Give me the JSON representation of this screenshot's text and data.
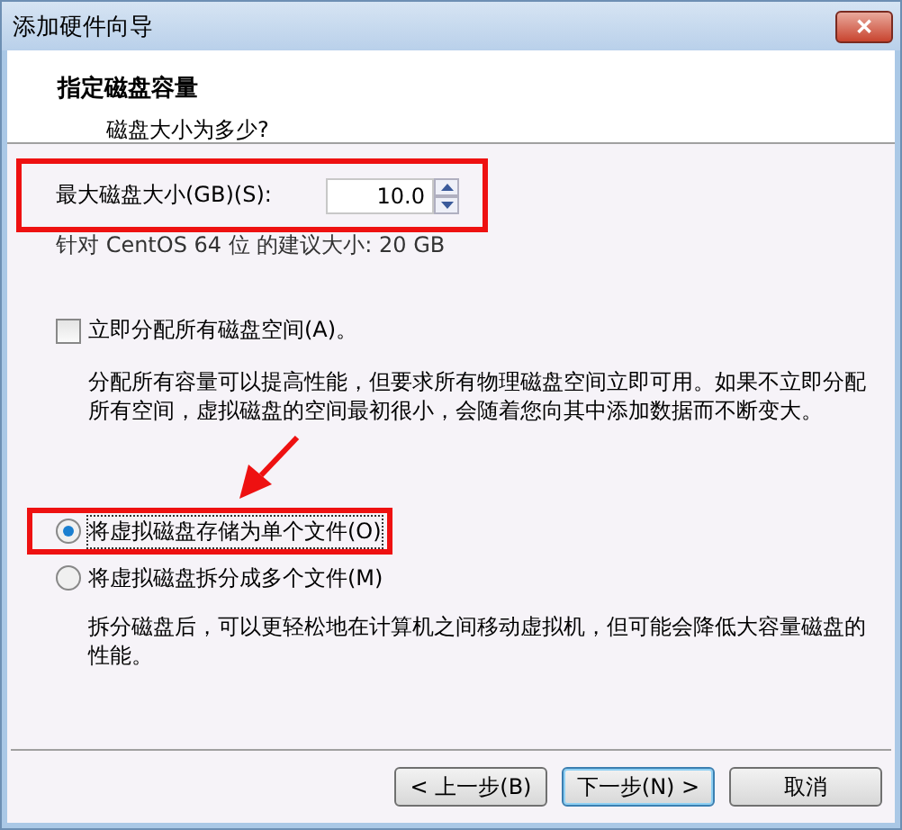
{
  "window": {
    "title": "添加硬件向导",
    "close_label": "✕"
  },
  "header": {
    "title": "指定磁盘容量",
    "subtitle": "磁盘大小为多少?"
  },
  "size_field": {
    "label": "最大磁盘大小(GB)(S):",
    "value": "10.0",
    "highlighted": true,
    "hint": "针对 CentOS 64 位 的建议大小: 20 GB"
  },
  "allocate": {
    "label": "立即分配所有磁盘空间(A)。",
    "checked": false,
    "description": "分配所有容量可以提高性能，但要求所有物理磁盘空间立即可用。如果不立即分配所有空间，虚拟磁盘的空间最初很小，会随着您向其中添加数据而不断变大。"
  },
  "storage_options": [
    {
      "label": "将虚拟磁盘存储为单个文件(O)",
      "selected": true,
      "highlighted": true
    },
    {
      "label": "将虚拟磁盘拆分成多个文件(M)",
      "selected": false,
      "highlighted": false,
      "description": "拆分磁盘后，可以更轻松地在计算机之间移动虚拟机，但可能会降低大容量磁盘的性能。"
    }
  ],
  "annotation_arrow": true,
  "buttons": [
    {
      "label": "< 上一步(B)",
      "default": false
    },
    {
      "label": "下一步(N) >",
      "default": true
    },
    {
      "label": "取消",
      "default": false
    }
  ]
}
